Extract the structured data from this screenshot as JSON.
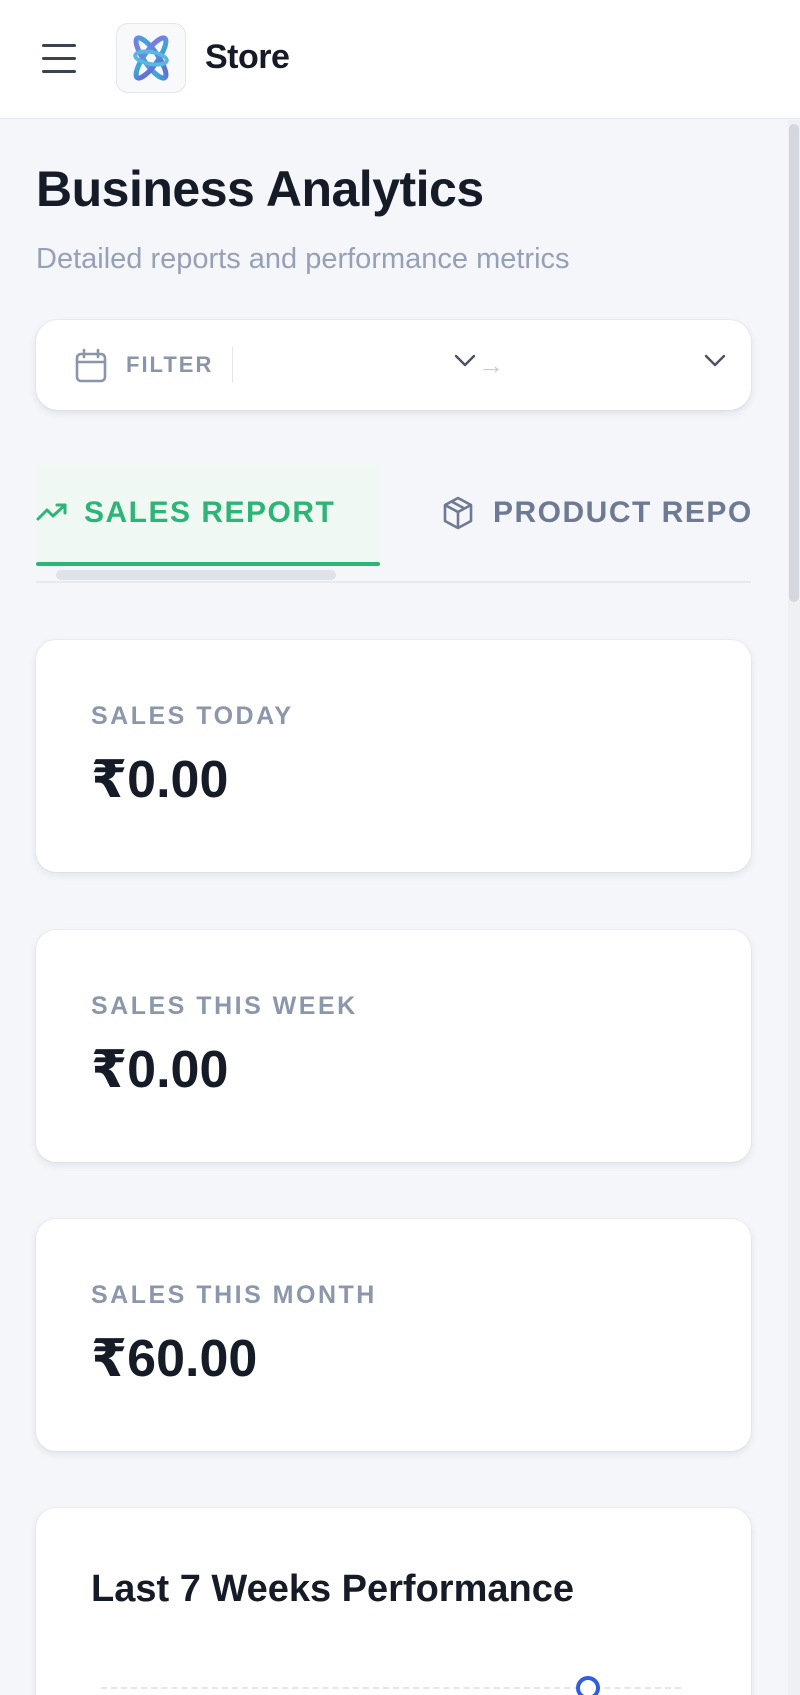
{
  "header": {
    "store_name": "Store",
    "menu_icon": "hamburger-menu-icon",
    "logo": "store-logo"
  },
  "page": {
    "title": "Business Analytics",
    "subtitle": "Detailed reports and performance metrics"
  },
  "filter": {
    "label": "FILTER",
    "icon": "calendar-icon",
    "start_value": "",
    "end_value": "",
    "separator": "→"
  },
  "tabs": [
    {
      "label": "SALES REPORT",
      "icon": "trending-up-icon",
      "active": true
    },
    {
      "label": "PRODUCT REPO",
      "icon": "package-icon",
      "active": false
    }
  ],
  "cards": [
    {
      "label": "SALES TODAY",
      "value": "₹0.00"
    },
    {
      "label": "SALES THIS WEEK",
      "value": "₹0.00"
    },
    {
      "label": "SALES THIS MONTH",
      "value": "₹60.00"
    }
  ],
  "chart": {
    "title": "Last 7 Weeks Performance"
  },
  "colors": {
    "accent_green": "#2db577",
    "chart_blue": "#2f5fe0",
    "text_dark": "#151b27",
    "text_muted": "#8c97ab"
  }
}
